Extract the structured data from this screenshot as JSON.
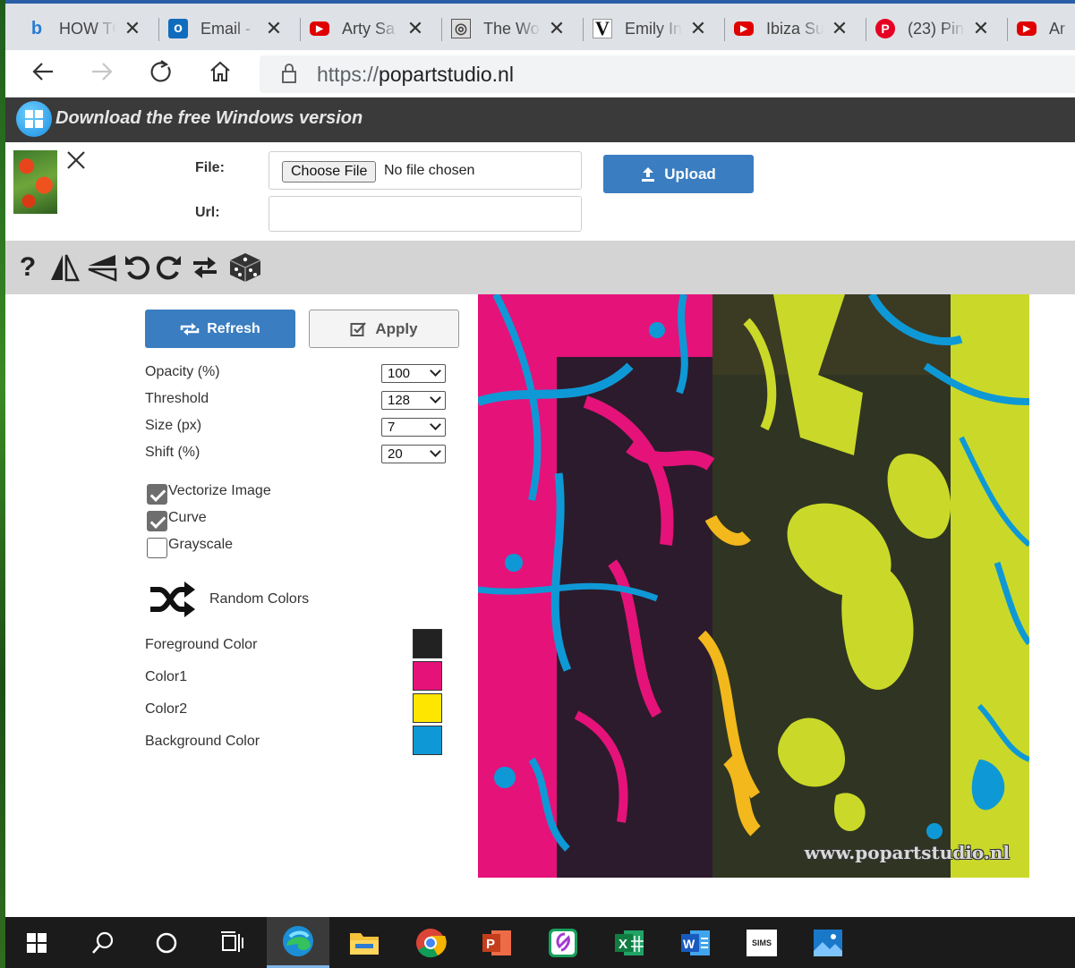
{
  "tabs": [
    {
      "title": "HOW TO",
      "favicon": "bing-icon",
      "color": "#2a7bd1"
    },
    {
      "title": "Email - ",
      "favicon": "outlook-icon",
      "color": "#0f6cbd"
    },
    {
      "title": "Arty Sa",
      "favicon": "youtube-icon",
      "color": "#e00000"
    },
    {
      "title": "The Wo",
      "favicon": "globe-icon",
      "color": "#444444"
    },
    {
      "title": "Emily In",
      "favicon": "vogue-icon",
      "color": "#111111"
    },
    {
      "title": "Ibiza Su",
      "favicon": "youtube-icon",
      "color": "#e00000"
    },
    {
      "title": "(23) Pin",
      "favicon": "pinterest-icon",
      "color": "#e60023"
    },
    {
      "title": "Ar",
      "favicon": "youtube-icon",
      "color": "#e00000"
    }
  ],
  "address": {
    "protocol": "https://",
    "host": "popartstudio.nl"
  },
  "promo": {
    "text": "Download the free Windows version"
  },
  "upload": {
    "file_label": "File:",
    "choose_label": "Choose File",
    "no_file_text": "No file chosen",
    "url_label": "Url:",
    "url_value": "",
    "upload_label": "Upload"
  },
  "tools": {
    "help": "?"
  },
  "controls": {
    "refresh_label": "Refresh",
    "apply_label": "Apply",
    "params": [
      {
        "label": "Opacity (%)",
        "value": "100"
      },
      {
        "label": "Threshold",
        "value": "128"
      },
      {
        "label": "Size (px)",
        "value": "7"
      },
      {
        "label": "Shift (%)",
        "value": "20"
      }
    ],
    "checkboxes": [
      {
        "label": "Vectorize Image",
        "checked": true
      },
      {
        "label": "Curve",
        "checked": true
      },
      {
        "label": "Grayscale",
        "checked": false
      }
    ],
    "random_label": "Random Colors",
    "colors": [
      {
        "label": "Foreground Color",
        "hex": "#222222"
      },
      {
        "label": "Color1",
        "hex": "#e5127a"
      },
      {
        "label": "Color2",
        "hex": "#ffe600"
      },
      {
        "label": "Background Color",
        "hex": "#0e99d6"
      }
    ]
  },
  "artwork": {
    "watermark": "www.popartstudio.nl"
  },
  "taskbar": {
    "items": [
      "windows-start-icon",
      "search-icon",
      "cortana-icon",
      "task-view-icon",
      "edge-icon",
      "file-explorer-icon",
      "chrome-icon",
      "powerpoint-icon",
      "whiteboard-icon",
      "excel-icon",
      "word-icon",
      "sims-icon",
      "photos-icon"
    ],
    "sims_text": "SIMS"
  }
}
